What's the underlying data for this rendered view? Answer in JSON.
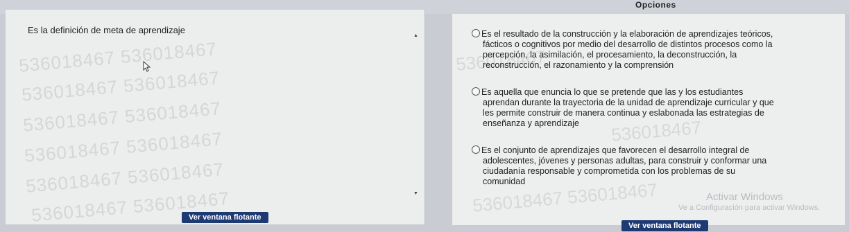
{
  "header": {
    "options_title": "Opciones"
  },
  "question": {
    "text": "Es la definición de meta de aprendizaje"
  },
  "watermark": {
    "code": "536018467"
  },
  "options": [
    {
      "line1": "Es el resultado de la construcción y la elaboración de aprendizajes teóricos,",
      "line2": "fácticos o cognitivos por medio del desarrollo de distintos procesos como la",
      "line3": "percepción, la asimilación, el procesamiento, la deconstrucción, la",
      "line4": "reconstrucción, el razonamiento y la comprensión"
    },
    {
      "line1": "Es aquella que enuncia lo que se pretende que las y los estudiantes",
      "line2": "aprendan durante la trayectoria de la unidad de aprendizaje curricular y que",
      "line3": "les permite construir de manera continua y eslabonada las estrategias de",
      "line4": "enseñanza y aprendizaje"
    },
    {
      "line1": "Es el conjunto de aprendizajes que favorecen el desarrollo integral de",
      "line2": "adolescentes, jóvenes y personas adultas, para construir y conformar una",
      "line3": "ciudadanía responsable y comprometida con los problemas de su",
      "line4": "comunidad"
    }
  ],
  "buttons": {
    "float_left": "Ver ventana flotante",
    "float_right": "Ver ventana flotante"
  },
  "windows": {
    "activate_title": "Activar Windows",
    "activate_sub": "Ve a Configuración para activar Windows."
  }
}
